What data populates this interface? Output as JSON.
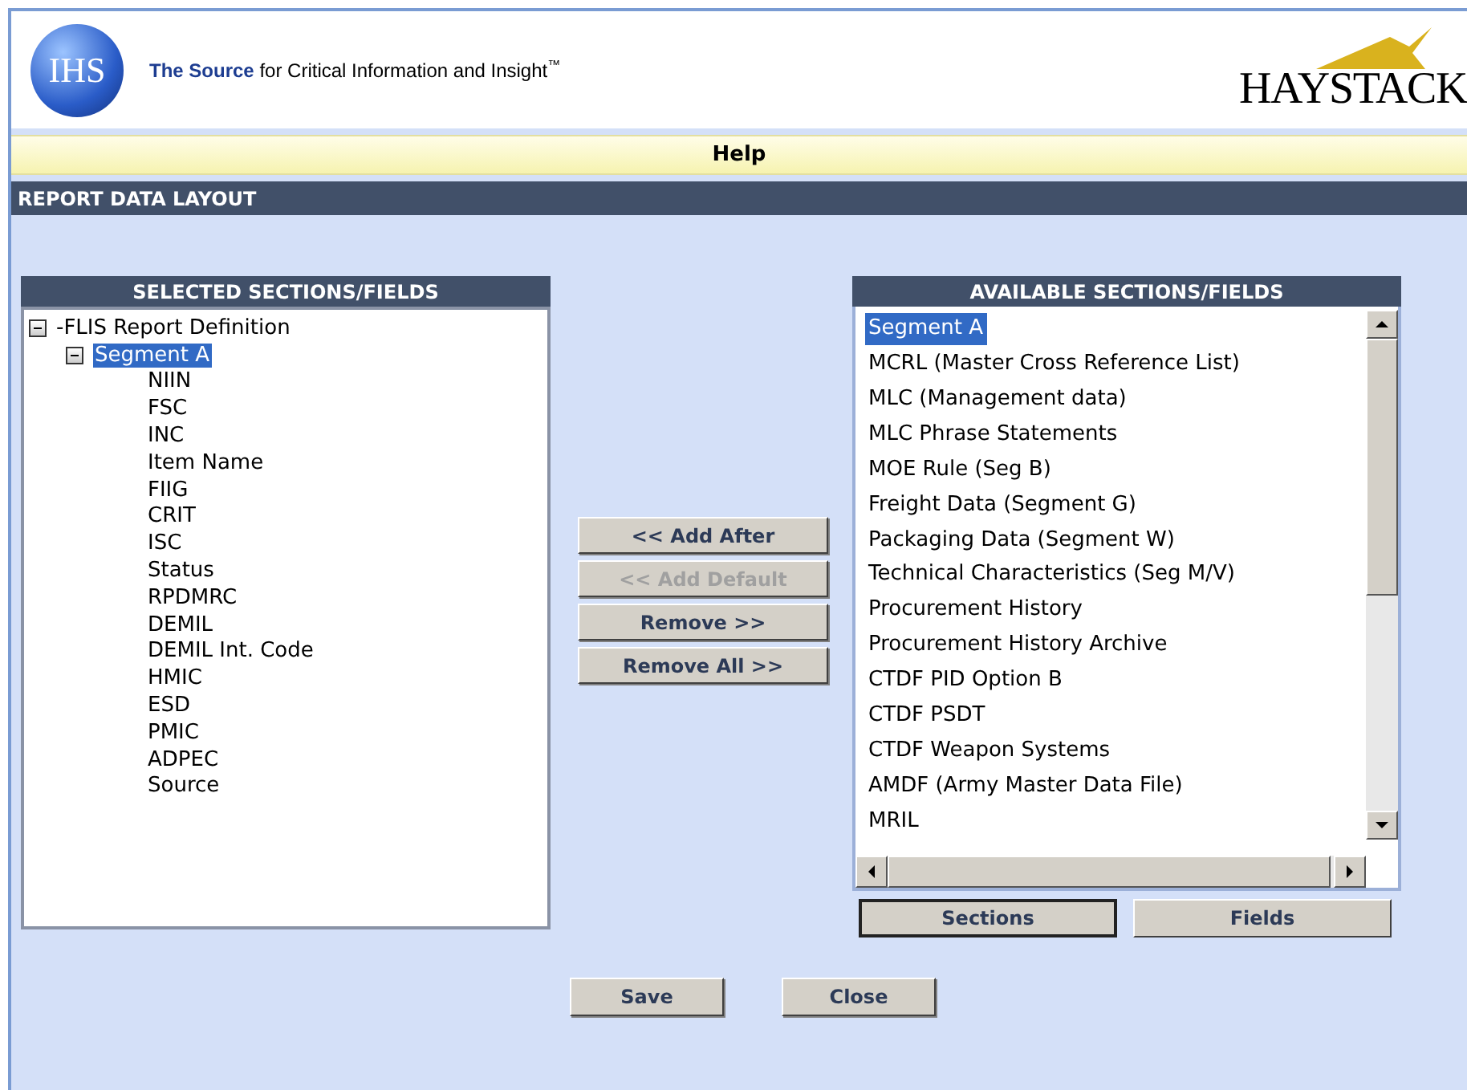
{
  "header": {
    "logo_text": "IHS",
    "tagline_bold": "The Source",
    "tagline": "for Critical Information and Insight",
    "trademark": "™",
    "brand": "HAYSTACK"
  },
  "help_bar": {
    "label": "Help"
  },
  "title_bar": {
    "title": "REPORT DATA LAYOUT"
  },
  "selected_panel": {
    "title": "SELECTED SECTIONS/FIELDS",
    "tree": [
      {
        "label": "-FLIS Report Definition",
        "expanded": true,
        "selected": false,
        "children": [
          {
            "label": "Segment A",
            "expanded": true,
            "selected": true,
            "children": [
              {
                "label": "NIIN",
                "selected": false
              },
              {
                "label": "FSC",
                "selected": false
              },
              {
                "label": "INC",
                "selected": false
              },
              {
                "label": "Item Name",
                "selected": false
              },
              {
                "label": "FIIG",
                "selected": false
              },
              {
                "label": "CRIT",
                "selected": false
              },
              {
                "label": "ISC",
                "selected": false
              },
              {
                "label": "Status",
                "selected": false
              },
              {
                "label": "RPDMRC",
                "selected": false
              },
              {
                "label": "DEMIL",
                "selected": false
              },
              {
                "label": "DEMIL Int. Code",
                "selected": false
              },
              {
                "label": "HMIC",
                "selected": false
              },
              {
                "label": "ESD",
                "selected": false
              },
              {
                "label": "PMIC",
                "selected": false
              },
              {
                "label": "ADPEC",
                "selected": false
              },
              {
                "label": "Source",
                "selected": false
              }
            ]
          }
        ]
      }
    ]
  },
  "move_buttons": [
    {
      "label": "<< Add After",
      "disabled": false
    },
    {
      "label": "<< Add Default",
      "disabled": true
    },
    {
      "label": "Remove >>",
      "disabled": false
    },
    {
      "label": "Remove All >>",
      "disabled": false
    }
  ],
  "available_panel": {
    "title": "AVAILABLE SECTIONS/FIELDS",
    "items": [
      {
        "label": "Segment A",
        "selected": true
      },
      {
        "label": "MCRL (Master Cross Reference List)",
        "selected": false
      },
      {
        "label": "MLC (Management data)",
        "selected": false
      },
      {
        "label": "MLC Phrase Statements",
        "selected": false
      },
      {
        "label": "MOE Rule (Seg B)",
        "selected": false
      },
      {
        "label": "Freight Data (Segment G)",
        "selected": false
      },
      {
        "label": "Packaging Data (Segment W)",
        "selected": false
      },
      {
        "label": "Technical Characteristics (Seg M/V)",
        "selected": false
      },
      {
        "label": "Procurement History",
        "selected": false
      },
      {
        "label": "Procurement History Archive",
        "selected": false
      },
      {
        "label": "CTDF PID Option B",
        "selected": false
      },
      {
        "label": "CTDF PSDT",
        "selected": false
      },
      {
        "label": "CTDF Weapon Systems",
        "selected": false
      },
      {
        "label": "AMDF (Army Master Data File)",
        "selected": false
      },
      {
        "label": "MRIL",
        "selected": false
      }
    ],
    "view_tabs": [
      {
        "label": "Sections",
        "selected": true
      },
      {
        "label": "Fields",
        "selected": false
      }
    ]
  },
  "footer_buttons": [
    "Save",
    "Close"
  ]
}
